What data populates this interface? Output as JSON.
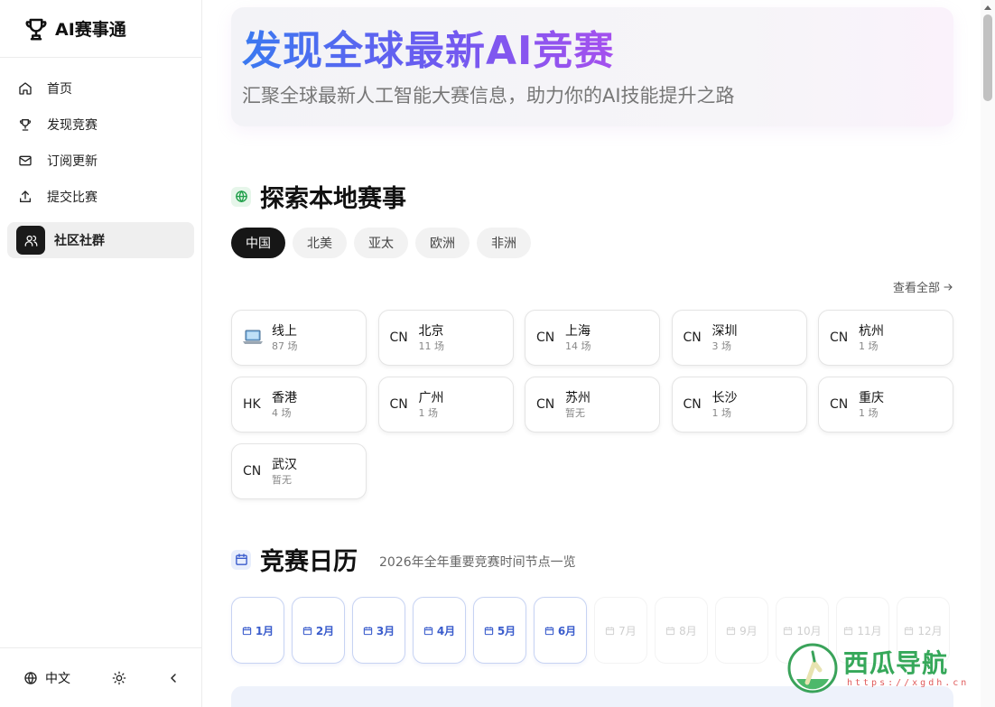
{
  "app": {
    "name": "AI赛事通"
  },
  "sidebar": {
    "items": [
      {
        "label": "首页",
        "icon": "home-icon"
      },
      {
        "label": "发现竞赛",
        "icon": "trophy-icon"
      },
      {
        "label": "订阅更新",
        "icon": "mail-icon"
      },
      {
        "label": "提交比赛",
        "icon": "upload-icon"
      },
      {
        "label": "社区社群",
        "icon": "users-icon",
        "active": true
      }
    ],
    "language": "中文"
  },
  "hero": {
    "title": "发现全球最新AI竞赛",
    "subtitle": "汇聚全球最新人工智能大赛信息，助力你的AI技能提升之路"
  },
  "local": {
    "title": "探索本地赛事",
    "tabs": [
      "中国",
      "北美",
      "亚太",
      "欧洲",
      "非洲"
    ],
    "active_tab": "中国",
    "view_all": "查看全部",
    "cities": [
      {
        "code": "",
        "name": "线上",
        "count": "87 场",
        "icon": "laptop-icon"
      },
      {
        "code": "CN",
        "name": "北京",
        "count": "11 场"
      },
      {
        "code": "CN",
        "name": "上海",
        "count": "14 场"
      },
      {
        "code": "CN",
        "name": "深圳",
        "count": "3 场"
      },
      {
        "code": "CN",
        "name": "杭州",
        "count": "1 场"
      },
      {
        "code": "HK",
        "name": "香港",
        "count": "4 场"
      },
      {
        "code": "CN",
        "name": "广州",
        "count": "1 场"
      },
      {
        "code": "CN",
        "name": "苏州",
        "count": "暂无"
      },
      {
        "code": "CN",
        "name": "长沙",
        "count": "1 场"
      },
      {
        "code": "CN",
        "name": "重庆",
        "count": "1 场"
      },
      {
        "code": "CN",
        "name": "武汉",
        "count": "暂无"
      }
    ]
  },
  "calendar": {
    "title": "竞赛日历",
    "description": "2026年全年重要竞赛时间节点一览",
    "months": [
      {
        "label": "1月",
        "active": true
      },
      {
        "label": "2月",
        "active": true
      },
      {
        "label": "3月",
        "active": true
      },
      {
        "label": "4月",
        "active": true
      },
      {
        "label": "5月",
        "active": true
      },
      {
        "label": "6月",
        "active": true
      },
      {
        "label": "7月",
        "active": false
      },
      {
        "label": "8月",
        "active": false
      },
      {
        "label": "9月",
        "active": false
      },
      {
        "label": "10月",
        "active": false
      },
      {
        "label": "11月",
        "active": false
      },
      {
        "label": "12月",
        "active": false
      }
    ]
  },
  "watermark": {
    "title": "西瓜导航",
    "url": "https://xgdh.cn"
  },
  "colors": {
    "accent_blue": "#3a79f0",
    "accent_purple": "#a550ee",
    "active_dark": "#161616"
  }
}
